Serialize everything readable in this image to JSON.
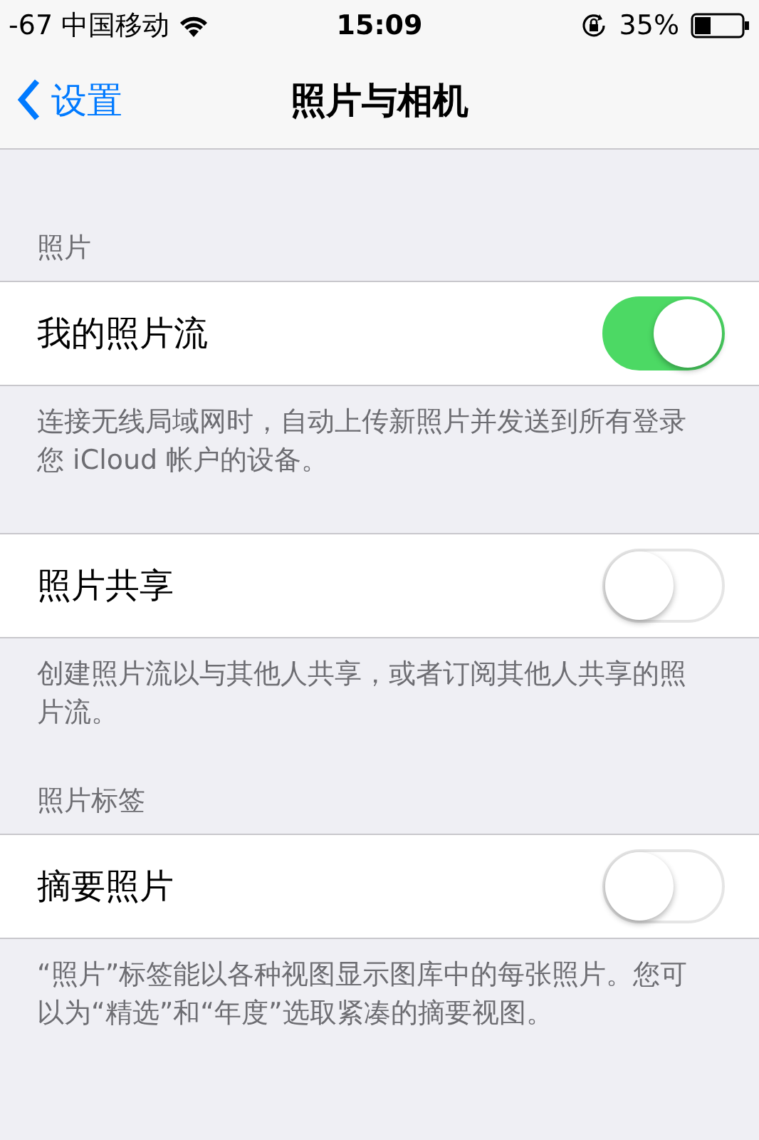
{
  "status_bar": {
    "signal": "-67",
    "carrier": "中国移动",
    "time": "15:09",
    "battery": "35%"
  },
  "nav": {
    "back": "设置",
    "title": "照片与相机"
  },
  "sections": [
    {
      "header": "照片",
      "rows": [
        {
          "label": "我的照片流",
          "on": true
        }
      ],
      "footer": "连接无线局域网时，自动上传新照片并发送到所有登录您 iCloud 帐户的设备。"
    },
    {
      "rows": [
        {
          "label": "照片共享",
          "on": false
        }
      ],
      "footer": "创建照片流以与其他人共享，或者订阅其他人共享的照片流。"
    },
    {
      "header": "照片标签",
      "rows": [
        {
          "label": "摘要照片",
          "on": false
        }
      ],
      "footer": "“照片”标签能以各种视图显示图库中的每张照片。您可以为“精选”和“年度”选取紧凑的摘要视图。"
    }
  ]
}
